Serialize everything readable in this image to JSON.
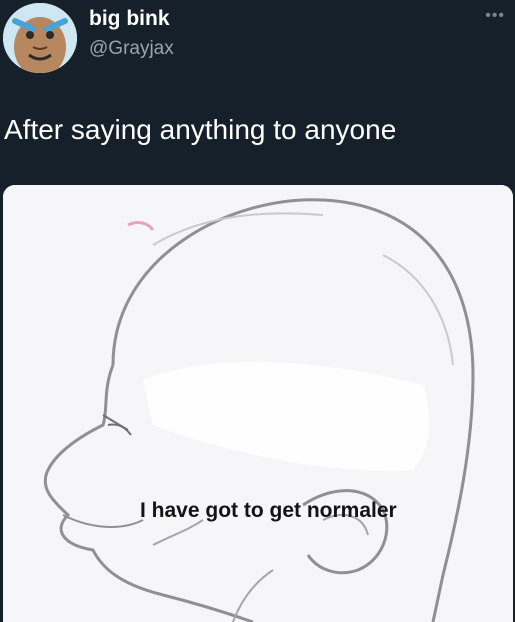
{
  "tweet": {
    "display_name": "big bink",
    "handle": "@Grayjax",
    "more_label": "•••",
    "text": "After saying anything to anyone",
    "avatar_icon": "cartoon-face-avatar"
  },
  "media": {
    "caption": "I have got to get  normaler",
    "illustration_icon": "head-outline-brain-meme"
  },
  "colors": {
    "background": "#15202b",
    "name": "#ffffff",
    "handle": "#9aa3ab",
    "meme_bg": "#f6f6f8"
  }
}
